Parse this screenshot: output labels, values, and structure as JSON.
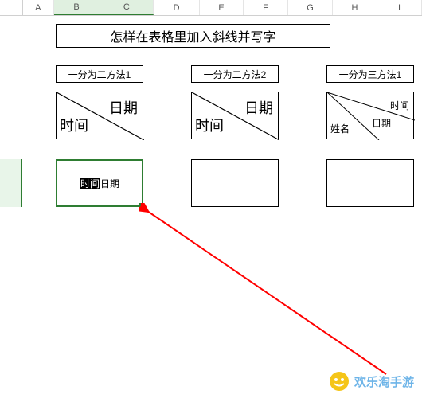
{
  "columns": [
    "A",
    "B",
    "C",
    "D",
    "E",
    "F",
    "G",
    "H",
    "I"
  ],
  "title": "怎样在表格里加入斜线并写字",
  "methods": {
    "m1": "一分为二方法1",
    "m2": "一分为二方法2",
    "m3": "一分为三方法1"
  },
  "diag1": {
    "top": "日期",
    "bottom": "时间"
  },
  "diag2": {
    "top": "日期",
    "bottom": "时间"
  },
  "diag3": {
    "top": "时间",
    "mid": "日期",
    "bottom": "姓名"
  },
  "editing": {
    "sel": "时间",
    "rest": "日期"
  },
  "watermark": "欢乐淘手游"
}
